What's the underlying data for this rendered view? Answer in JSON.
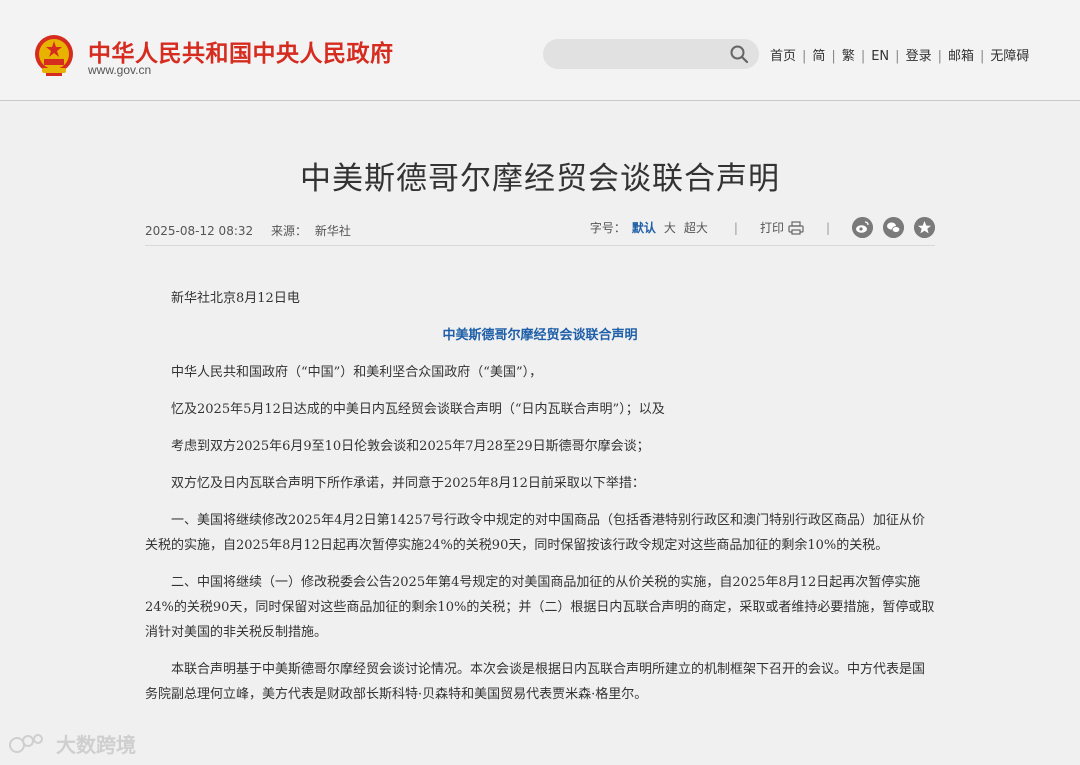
{
  "header": {
    "site_title": "中华人民共和国中央人民政府",
    "site_domain": "www.gov.cn",
    "search": {
      "value": "",
      "placeholder": ""
    },
    "nav": [
      {
        "label": "首页"
      },
      {
        "label": "简"
      },
      {
        "label": "繁"
      },
      {
        "label": "EN"
      },
      {
        "label": "登录"
      },
      {
        "label": "邮箱"
      },
      {
        "label": "无障碍"
      }
    ]
  },
  "article": {
    "title": "中美斯德哥尔摩经贸会谈联合声明",
    "date": "2025-08-12 08:32",
    "source_label": "来源：",
    "source": "新华社",
    "font_size_label": "字号：",
    "font_sizes": [
      {
        "label": "默认",
        "active": true
      },
      {
        "label": "大",
        "active": false
      },
      {
        "label": "超大",
        "active": false
      }
    ],
    "print_label": "打印",
    "share_icons": [
      "weibo-icon",
      "wechat-icon",
      "favorite-icon"
    ],
    "paragraphs": [
      {
        "text": "新华社北京8月12日电",
        "style": "normal"
      },
      {
        "text": "中美斯德哥尔摩经贸会谈联合声明",
        "style": "center"
      },
      {
        "text": "中华人民共和国政府（“中国”）和美利坚合众国政府（“美国”），",
        "style": "normal"
      },
      {
        "text": "忆及2025年5月12日达成的中美日内瓦经贸会谈联合声明（“日内瓦联合声明”）；以及",
        "style": "normal"
      },
      {
        "text": "考虑到双方2025年6月9至10日伦敦会谈和2025年7月28至29日斯德哥尔摩会谈；",
        "style": "normal"
      },
      {
        "text": "双方忆及日内瓦联合声明下所作承诺，并同意于2025年8月12日前采取以下举措：",
        "style": "normal"
      },
      {
        "text": "一、美国将继续修改2025年4月2日第14257号行政令中规定的对中国商品（包括香港特别行政区和澳门特别行政区商品）加征从价关税的实施，自2025年8月12日起再次暂停实施24%的关税90天，同时保留按该行政令规定对这些商品加征的剩余10%的关税。",
        "style": "normal"
      },
      {
        "text": "二、中国将继续（一）修改税委会公告2025年第4号规定的对美国商品加征的从价关税的实施，自2025年8月12日起再次暂停实施24%的关税90天，同时保留对这些商品加征的剩余10%的关税；并（二）根据日内瓦联合声明的商定，采取或者维持必要措施，暂停或取消针对美国的非关税反制措施。",
        "style": "normal"
      },
      {
        "text": "本联合声明基于中美斯德哥尔摩经贸会谈讨论情况。本次会谈是根据日内瓦联合声明所建立的机制框架下召开的会议。中方代表是国务院副总理何立峰，美方代表是财政部长斯科特·贝森特和美国贸易代表贾米森·格里尔。",
        "style": "normal"
      }
    ]
  },
  "watermark": {
    "text": "大数跨境"
  },
  "colors": {
    "brand_red": "#d62b1f",
    "link_blue": "#1f5fa8",
    "background": "#f0f0f0"
  }
}
